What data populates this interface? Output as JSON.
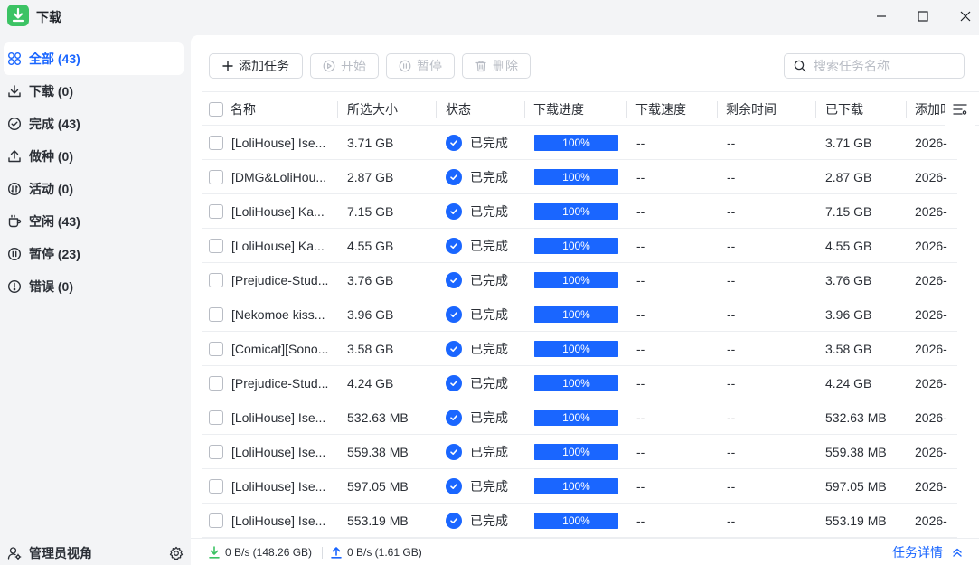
{
  "app": {
    "title": "下载"
  },
  "colors": {
    "accent": "#1a66ff",
    "app_icon": "#3cc364"
  },
  "sidebar": {
    "items": [
      {
        "label": "全部 (43)",
        "icon": "grid-icon",
        "active": true
      },
      {
        "label": "下载 (0)",
        "icon": "download-icon"
      },
      {
        "label": "完成 (43)",
        "icon": "check-circle-icon"
      },
      {
        "label": "做种 (0)",
        "icon": "upload-icon"
      },
      {
        "label": "活动 (0)",
        "icon": "activity-icon"
      },
      {
        "label": "空闲 (43)",
        "icon": "coffee-cup-icon"
      },
      {
        "label": "暂停 (23)",
        "icon": "pause-circle-icon"
      },
      {
        "label": "错误 (0)",
        "icon": "error-circle-icon"
      }
    ],
    "admin_label": "管理员视角"
  },
  "toolbar": {
    "add_label": "添加任务",
    "start_label": "开始",
    "pause_label": "暂停",
    "delete_label": "删除",
    "search_placeholder": "搜索任务名称"
  },
  "table": {
    "headers": [
      "名称",
      "所选大小",
      "状态",
      "下载进度",
      "下载速度",
      "剩余时间",
      "已下载",
      "添加时"
    ],
    "rows": [
      {
        "name": "[LoliHouse] Ise...",
        "size": "3.71 GB",
        "status": "已完成",
        "progress": 100,
        "progress_text": "100%",
        "speed": "--",
        "remaining": "--",
        "downloaded": "3.71 GB",
        "added": "2026-"
      },
      {
        "name": "[DMG&LoliHou...",
        "size": "2.87 GB",
        "status": "已完成",
        "progress": 100,
        "progress_text": "100%",
        "speed": "--",
        "remaining": "--",
        "downloaded": "2.87 GB",
        "added": "2026-"
      },
      {
        "name": "[LoliHouse] Ka...",
        "size": "7.15 GB",
        "status": "已完成",
        "progress": 100,
        "progress_text": "100%",
        "speed": "--",
        "remaining": "--",
        "downloaded": "7.15 GB",
        "added": "2026-"
      },
      {
        "name": "[LoliHouse] Ka...",
        "size": "4.55 GB",
        "status": "已完成",
        "progress": 100,
        "progress_text": "100%",
        "speed": "--",
        "remaining": "--",
        "downloaded": "4.55 GB",
        "added": "2026-"
      },
      {
        "name": "[Prejudice-Stud...",
        "size": "3.76 GB",
        "status": "已完成",
        "progress": 100,
        "progress_text": "100%",
        "speed": "--",
        "remaining": "--",
        "downloaded": "3.76 GB",
        "added": "2026-"
      },
      {
        "name": "[Nekomoe kiss...",
        "size": "3.96 GB",
        "status": "已完成",
        "progress": 100,
        "progress_text": "100%",
        "speed": "--",
        "remaining": "--",
        "downloaded": "3.96 GB",
        "added": "2026-"
      },
      {
        "name": "[Comicat][Sono...",
        "size": "3.58 GB",
        "status": "已完成",
        "progress": 100,
        "progress_text": "100%",
        "speed": "--",
        "remaining": "--",
        "downloaded": "3.58 GB",
        "added": "2026-"
      },
      {
        "name": "[Prejudice-Stud...",
        "size": "4.24 GB",
        "status": "已完成",
        "progress": 100,
        "progress_text": "100%",
        "speed": "--",
        "remaining": "--",
        "downloaded": "4.24 GB",
        "added": "2026-"
      },
      {
        "name": "[LoliHouse] Ise...",
        "size": "532.63 MB",
        "status": "已完成",
        "progress": 100,
        "progress_text": "100%",
        "speed": "--",
        "remaining": "--",
        "downloaded": "532.63 MB",
        "added": "2026-"
      },
      {
        "name": "[LoliHouse] Ise...",
        "size": "559.38 MB",
        "status": "已完成",
        "progress": 100,
        "progress_text": "100%",
        "speed": "--",
        "remaining": "--",
        "downloaded": "559.38 MB",
        "added": "2026-"
      },
      {
        "name": "[LoliHouse] Ise...",
        "size": "597.05 MB",
        "status": "已完成",
        "progress": 100,
        "progress_text": "100%",
        "speed": "--",
        "remaining": "--",
        "downloaded": "597.05 MB",
        "added": "2026-"
      },
      {
        "name": "[LoliHouse] Ise...",
        "size": "553.19 MB",
        "status": "已完成",
        "progress": 100,
        "progress_text": "100%",
        "speed": "--",
        "remaining": "--",
        "downloaded": "553.19 MB",
        "added": "2026-"
      }
    ]
  },
  "statusbar": {
    "download_rate": "0 B/s (148.26 GB)",
    "upload_rate": "0 B/s (1.61 GB)",
    "task_detail_label": "任务详情"
  }
}
